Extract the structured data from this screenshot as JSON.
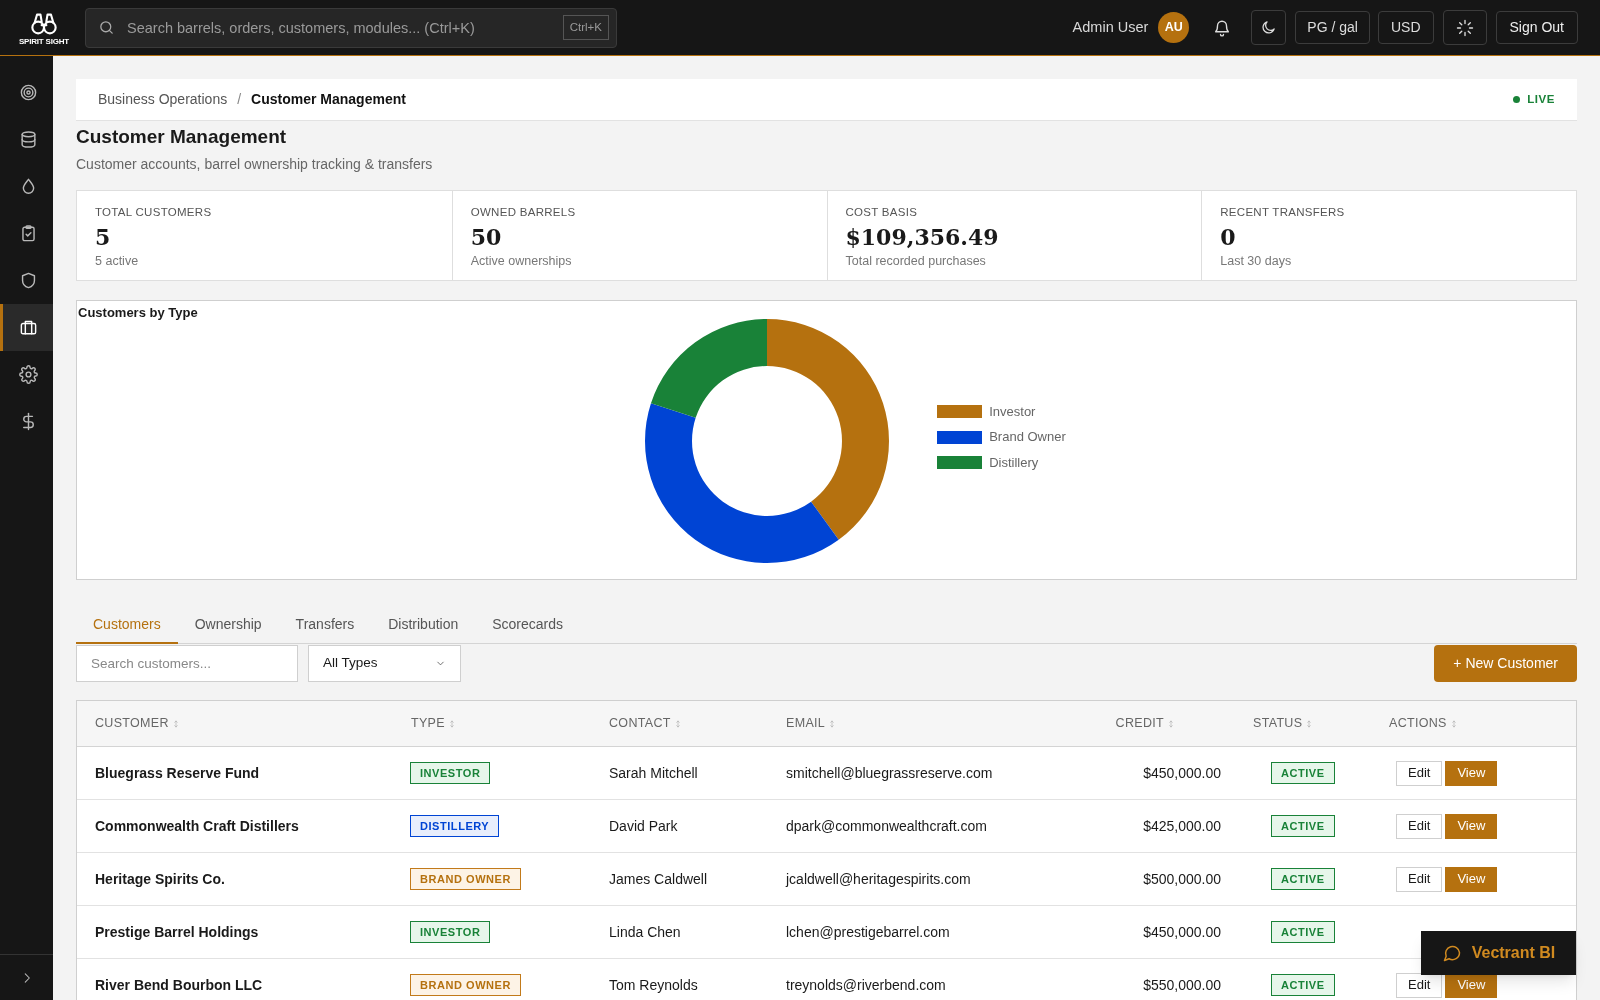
{
  "header": {
    "logo_text": "SPIRIT SIGHT",
    "search": {
      "placeholder": "Search barrels, orders, customers, modules... (Ctrl+K)",
      "shortcut": "Ctrl+K"
    },
    "user_name": "Admin User",
    "avatar_initials": "AU",
    "unit_button": "PG / gal",
    "currency_button": "USD",
    "sign_out": "Sign Out"
  },
  "sidebar": {
    "items": [
      {
        "selected": false
      },
      {
        "selected": false
      },
      {
        "selected": false
      },
      {
        "selected": false
      },
      {
        "selected": false
      },
      {
        "selected": true
      },
      {
        "selected": false
      },
      {
        "selected": false
      }
    ]
  },
  "breadcrumb": [
    "Business Operations",
    "Customer Management"
  ],
  "breadcrumb_separator": "/",
  "live_label": "LIVE",
  "title": "Customer Management",
  "subtitle": "Customer accounts, barrel ownership tracking & transfers",
  "stats": [
    {
      "label": "TOTAL CUSTOMERS",
      "value": "5",
      "note": "5 active"
    },
    {
      "label": "OWNED BARRELS",
      "value": "50",
      "note": "Active ownerships"
    },
    {
      "label": "COST BASIS",
      "value": "$109,356.49",
      "note": "Total recorded purchases"
    },
    {
      "label": "RECENT TRANSFERS",
      "value": "0",
      "note": "Last 30 days"
    }
  ],
  "chart": {
    "chart_data": {
      "type": "donut",
      "title": "Customers by Type",
      "categories": [
        "Investor",
        "Brand Owner",
        "Distillery"
      ],
      "values": [
        40,
        40,
        20
      ],
      "colors": [
        "#b5710f",
        "#0044d4",
        "#198238"
      ],
      "legend": true
    }
  },
  "tabs": [
    {
      "label": "Customers",
      "selected": true
    },
    {
      "label": "Ownership",
      "selected": false
    },
    {
      "label": "Transfers",
      "selected": false
    },
    {
      "label": "Distribution",
      "selected": false
    },
    {
      "label": "Scorecards",
      "selected": false
    }
  ],
  "filters": {
    "search_placeholder": "Search customers...",
    "type_select": "All Types",
    "new_button": "+ New Customer"
  },
  "table": {
    "columns": [
      "CUSTOMER",
      "TYPE",
      "CONTACT",
      "EMAIL",
      "CREDIT",
      "STATUS",
      "ACTIONS"
    ],
    "rows": [
      {
        "customer": "Bluegrass Reserve Fund",
        "type": {
          "kind": "investor",
          "label": "INVESTOR"
        },
        "contact": "Sarah Mitchell",
        "email": "smitchell@bluegrassreserve.com",
        "credit": "$450,000.00",
        "status": {
          "kind": "active",
          "label": "ACTIVE"
        },
        "actions": [
          "Edit",
          "View"
        ]
      },
      {
        "customer": "Commonwealth Craft Distillers",
        "type": {
          "kind": "distillery",
          "label": "DISTILLERY"
        },
        "contact": "David Park",
        "email": "dpark@commonwealthcraft.com",
        "credit": "$425,000.00",
        "status": {
          "kind": "active",
          "label": "ACTIVE"
        },
        "actions": [
          "Edit",
          "View"
        ]
      },
      {
        "customer": "Heritage Spirits Co.",
        "type": {
          "kind": "brand_owner",
          "label": "BRAND OWNER"
        },
        "contact": "James Caldwell",
        "email": "jcaldwell@heritagespirits.com",
        "credit": "$500,000.00",
        "status": {
          "kind": "active",
          "label": "ACTIVE"
        },
        "actions": [
          "Edit",
          "View"
        ]
      },
      {
        "customer": "Prestige Barrel Holdings",
        "type": {
          "kind": "investor",
          "label": "INVESTOR"
        },
        "contact": "Linda Chen",
        "email": "lchen@prestigebarrel.com",
        "credit": "$450,000.00",
        "status": {
          "kind": "active",
          "label": "ACTIVE"
        }
      },
      {
        "customer": "River Bend Bourbon LLC",
        "type": {
          "kind": "brand_owner",
          "label": "BRAND OWNER"
        },
        "contact": "Tom Reynolds",
        "email": "treynolds@riverbend.com",
        "credit": "$550,000.00",
        "status": {
          "kind": "active",
          "label": "ACTIVE"
        },
        "actions": [
          "Edit",
          "View"
        ]
      }
    ]
  },
  "chat_button": "Vectrant BI"
}
